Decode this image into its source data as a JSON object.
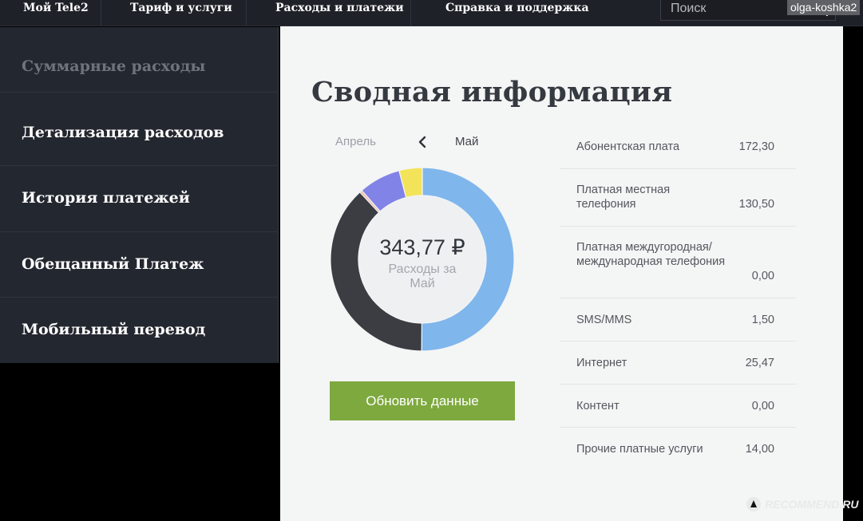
{
  "nav": {
    "items": [
      {
        "label": "Мой Tele2"
      },
      {
        "label": "Тариф и услуги"
      },
      {
        "label": "Расходы и платежи"
      },
      {
        "label": "Справка и поддержка"
      }
    ],
    "search_placeholder": "Поиск",
    "search_icon": "magnifier-icon",
    "user": "olga-koshka2"
  },
  "sidebar": {
    "items": [
      {
        "label": "Суммарные расходы",
        "active": true
      },
      {
        "label": "Детализация расходов"
      },
      {
        "label": "История платежей"
      },
      {
        "label": "Обещанный Платеж"
      },
      {
        "label": "Мобильный перевод"
      }
    ]
  },
  "summary": {
    "title": "Сводная информация",
    "prev_month": "Апрель",
    "current_month": "Май",
    "total": "343,77 ₽",
    "total_caption": "Расходы за Май",
    "refresh_label": "Обновить данные"
  },
  "chart_data": {
    "type": "pie",
    "style": "donut",
    "categories": [
      "Абонентская плата",
      "Платная местная телефония",
      "SMS/MMS",
      "Интернет",
      "Прочие платные услуги"
    ],
    "values": [
      172.3,
      130.5,
      1.5,
      25.47,
      14.0
    ],
    "colors": [
      "#7fb6ec",
      "#3b3d42",
      "#f2b7a2",
      "#8283e6",
      "#f3e35a"
    ]
  },
  "expenses": [
    {
      "label": "Абонентская плата",
      "value": "172,30"
    },
    {
      "label": "Платная местная телефония",
      "value": "130,50"
    },
    {
      "label": "Платная междугородная/ международная телефония",
      "value": "0,00"
    },
    {
      "label": "SMS/MMS",
      "value": "1,50"
    },
    {
      "label": "Интернет",
      "value": "25,47"
    },
    {
      "label": "Контент",
      "value": "0,00"
    },
    {
      "label": "Прочие платные услуги",
      "value": "14,00"
    }
  ],
  "watermark": "RECOMMEND.RU"
}
